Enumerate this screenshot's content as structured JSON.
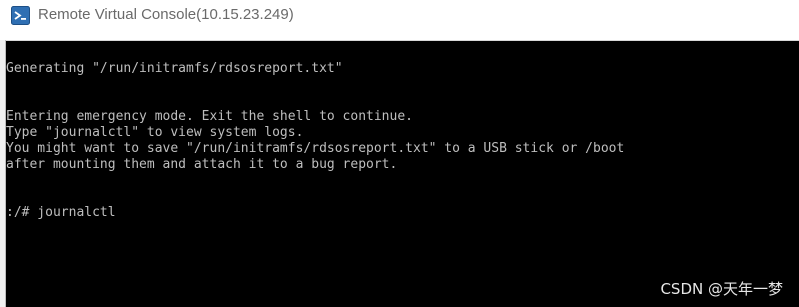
{
  "window": {
    "title": "Remote Virtual Console(10.15.23.249)",
    "icon": "java-app-icon"
  },
  "console": {
    "lines": [
      "Generating \"/run/initramfs/rdsosreport.txt\"",
      "Entering emergency mode. Exit the shell to continue.",
      "Type \"journalctl\" to view system logs.",
      "You might want to save \"/run/initramfs/rdsosreport.txt\" to a USB stick or /boot",
      "after mounting them and attach it to a bug report.",
      ":/# journalctl"
    ]
  },
  "watermark": {
    "text": "CSDN @天年一梦"
  },
  "colors": {
    "console_bg": "#000000",
    "console_fg": "#bebebe",
    "title_fg": "#6a6a6a"
  }
}
